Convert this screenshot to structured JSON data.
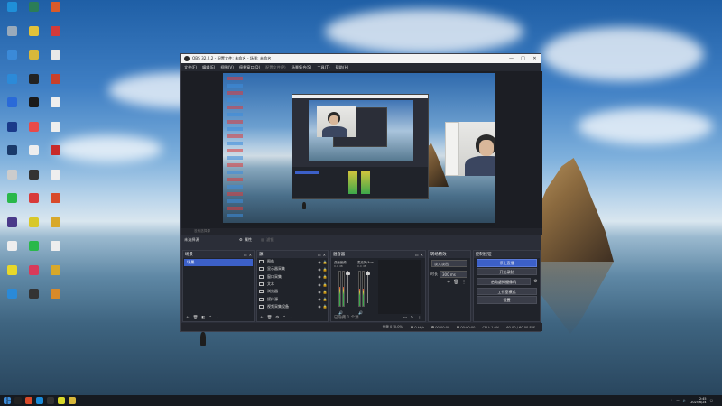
{
  "desktop": {
    "icons": [
      {
        "label": "",
        "color": "#1f8fd8"
      },
      {
        "label": "",
        "color": "#2b7d58"
      },
      {
        "label": "",
        "color": "#d85a2a"
      },
      {
        "label": "",
        "color": "#9ab"
      },
      {
        "label": "",
        "color": "#e2c23a"
      },
      {
        "label": "",
        "color": "#d23a3a"
      },
      {
        "label": "",
        "color": "#3b8ad8"
      },
      {
        "label": "",
        "color": "#d8b83a"
      },
      {
        "label": "",
        "color": "#e8e8e8"
      },
      {
        "label": "",
        "color": "#2c8ad8"
      },
      {
        "label": "",
        "color": "#222"
      },
      {
        "label": "",
        "color": "#c8402a"
      },
      {
        "label": "",
        "color": "#2a6ad8"
      },
      {
        "label": "",
        "color": "#1a1a1a"
      },
      {
        "label": "",
        "color": "#eee"
      },
      {
        "label": "",
        "color": "#1a3a8a"
      },
      {
        "label": "",
        "color": "#e84a4a"
      },
      {
        "label": "",
        "color": "#eee"
      },
      {
        "label": "",
        "color": "#1a3a6a"
      },
      {
        "label": "",
        "color": "#eee"
      },
      {
        "label": "",
        "color": "#c82a2a"
      },
      {
        "label": "",
        "color": "#ccc"
      },
      {
        "label": "",
        "color": "#333"
      },
      {
        "label": "",
        "color": "#eee"
      },
      {
        "label": "",
        "color": "#2ab84a"
      },
      {
        "label": "",
        "color": "#d83a3a"
      },
      {
        "label": "",
        "color": "#d84a2a"
      },
      {
        "label": "",
        "color": "#4a3a8a"
      },
      {
        "label": "",
        "color": "#d8c82a"
      },
      {
        "label": "",
        "color": "#d8a82a"
      },
      {
        "label": "",
        "color": "#eee"
      },
      {
        "label": "",
        "color": "#2ab84a"
      },
      {
        "label": "",
        "color": "#eee"
      },
      {
        "label": "",
        "color": "#e8d82a"
      },
      {
        "label": "",
        "color": "#d83a5a"
      },
      {
        "label": "",
        "color": "#d8a82a"
      },
      {
        "label": "",
        "color": "#2a8ad8"
      },
      {
        "label": "",
        "color": "#333"
      },
      {
        "label": "",
        "color": "#d88a2a"
      }
    ]
  },
  "obs": {
    "title": "OBS 32.2.2 - 配置文件: 未命名 - 场景: 未命名",
    "window_buttons": [
      "—",
      "□",
      "✕"
    ],
    "menu": [
      "文件(F)",
      "编辑(E)",
      "视图(V)",
      "停靠窗口(D)",
      "配置文件(P)",
      "场景集合(S)",
      "工具(T)",
      "帮助(H)"
    ],
    "context_bar": "没有选择源",
    "tabs": {
      "title": "未选择源",
      "properties": "属性",
      "filters": "滤镜"
    },
    "scenes": {
      "title": "场景",
      "items": [
        "场景"
      ]
    },
    "sources": {
      "title": "源",
      "items": [
        {
          "name": "图像",
          "selected": false
        },
        {
          "name": "显示器采集",
          "selected": false
        },
        {
          "name": "窗口采集",
          "selected": false
        },
        {
          "name": "文本",
          "selected": false
        },
        {
          "name": "浏览器",
          "selected": false
        },
        {
          "name": "媒体源",
          "selected": false
        },
        {
          "name": "视频采集设备",
          "selected": false
        }
      ]
    },
    "mixer": {
      "title": "混音器",
      "channels": [
        {
          "name": "桌面音频",
          "value": "0.0 dB",
          "level": 0.55
        },
        {
          "name": "麦克风/Aux",
          "value": "0.0 dB",
          "level": 0.5
        }
      ],
      "footer": "已隐藏 1 个源"
    },
    "transitions": {
      "title": "转场特效",
      "selected": "淡入淡出",
      "duration_label": "时长",
      "duration_value": "300 ms"
    },
    "controls": {
      "title": "控制按钮",
      "buttons": [
        "停止直播",
        "开始录制",
        "启动虚拟摄像机",
        "工作室模式",
        "设置"
      ]
    },
    "status": {
      "dropped": "丢帧 0 (0.0%)",
      "bitrate": "0 kb/s",
      "stream_time": "00:00:00",
      "rec_time": "00:00:00",
      "cpu": "CPU: 1.0%",
      "fps": "60.00 / 60.00 FPS"
    },
    "accent_color": "#3c60c8"
  },
  "taskbar": {
    "apps": [
      {
        "color": "#222"
      },
      {
        "color": "#d84a2a"
      },
      {
        "color": "#1a8ad8"
      },
      {
        "color": "#333"
      },
      {
        "color": "#d8d82a"
      },
      {
        "color": "#d8b83a"
      }
    ],
    "time": "2:45",
    "date": "2025/6/24"
  }
}
